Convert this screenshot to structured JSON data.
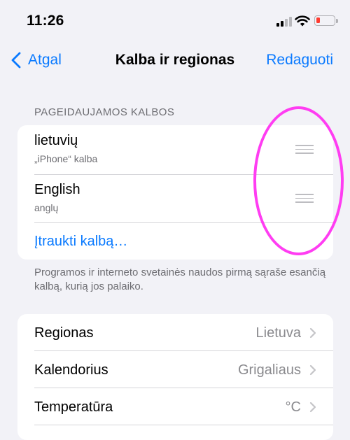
{
  "status_bar": {
    "time": "11:26",
    "battery_color": "#ff3b30"
  },
  "nav": {
    "back_label": "Atgal",
    "title": "Kalba ir regionas",
    "action_label": "Redaguoti"
  },
  "languages_section": {
    "header": "PAGEIDAUJAMOS KALBOS",
    "items": [
      {
        "name": "lietuvių",
        "subtitle": "„iPhone“ kalba"
      },
      {
        "name": "English",
        "subtitle": "anglų"
      }
    ],
    "add_label": "Įtraukti kalbą…",
    "footer": "Programos ir interneto svetainės naudos pirmą sąraše esančią kalbą, kurią jos palaiko."
  },
  "settings": [
    {
      "label": "Regionas",
      "value": "Lietuva"
    },
    {
      "label": "Kalendorius",
      "value": "Grigaliaus"
    },
    {
      "label": "Temperatūra",
      "value": "°C"
    }
  ],
  "colors": {
    "accent": "#0a7aff",
    "background": "#f2f2f7",
    "annotation": "#ff3df2"
  }
}
